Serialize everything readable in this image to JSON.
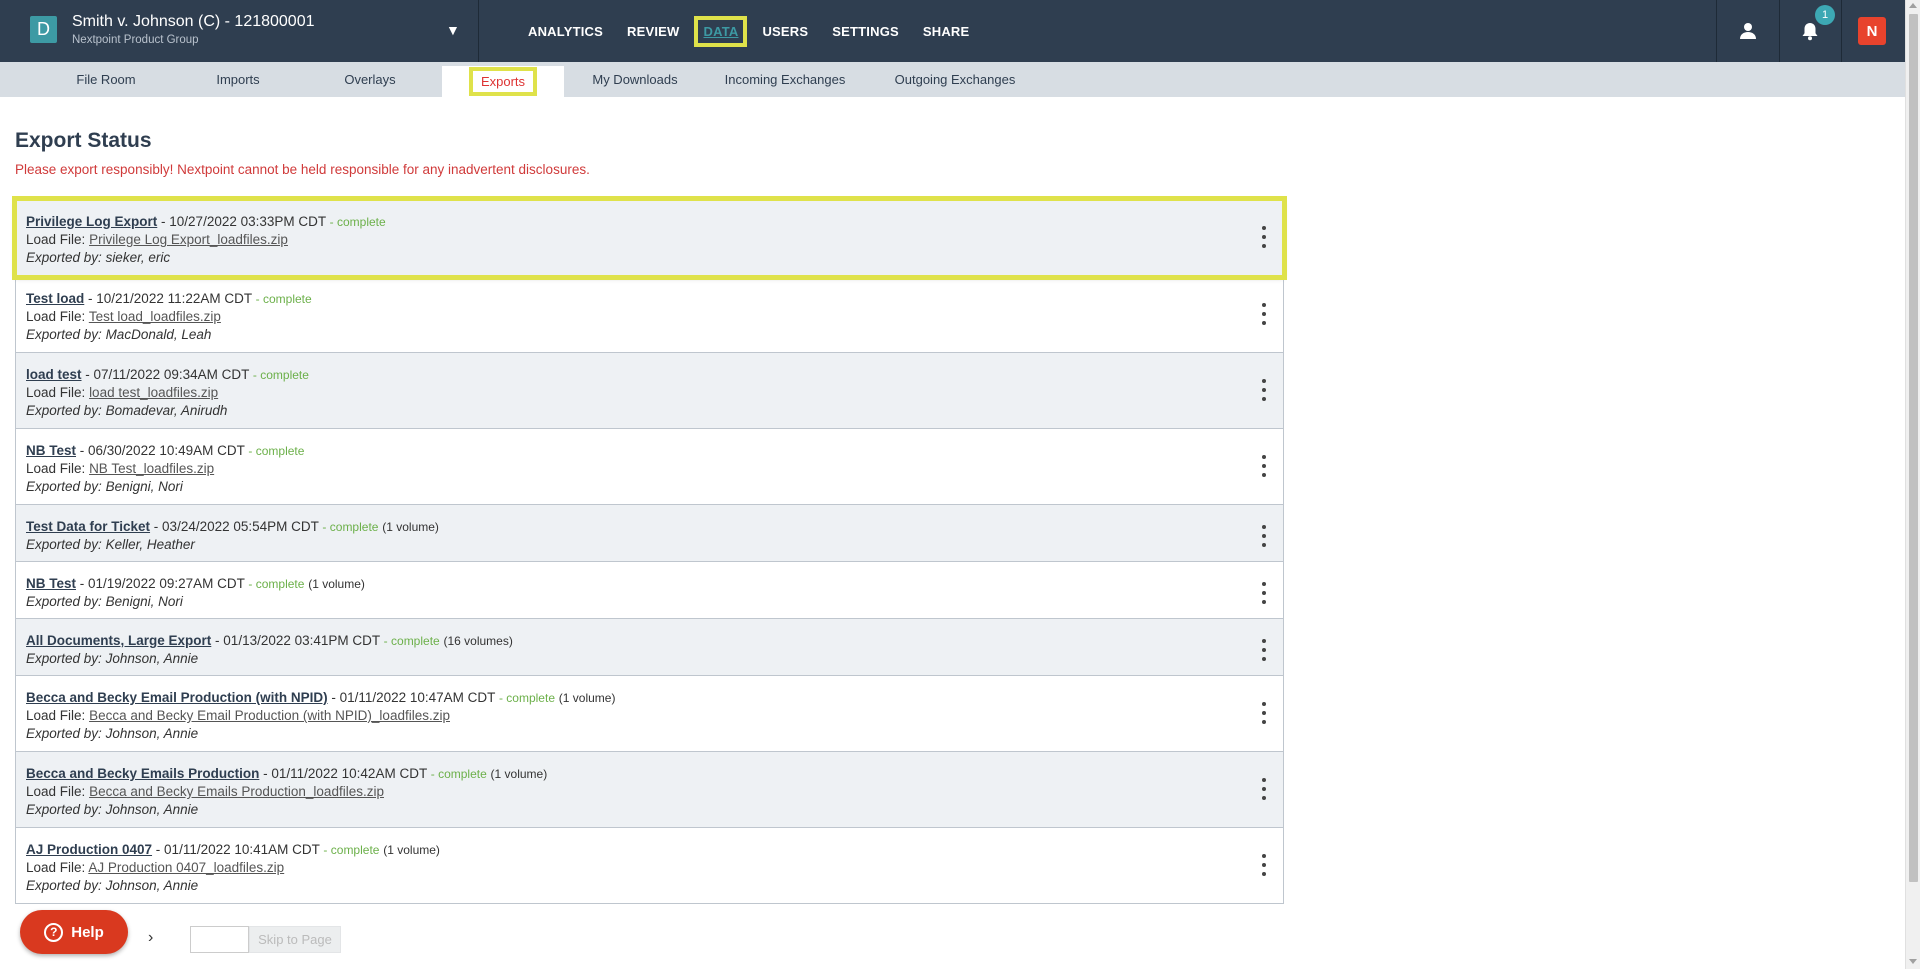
{
  "header": {
    "case_initial": "D",
    "case_title": "Smith v. Johnson (C) - 121800001",
    "case_subtitle": "Nextpoint Product Group",
    "dropdown_glyph": "▼",
    "nav": [
      "ANALYTICS",
      "REVIEW",
      "DATA",
      "USERS",
      "SETTINGS",
      "SHARE"
    ],
    "active_nav": "DATA",
    "notification_count": "1",
    "logo_text": "N"
  },
  "subnav": {
    "tabs": [
      "File Room",
      "Imports",
      "Overlays",
      "Exports",
      "My Downloads",
      "Incoming Exchanges",
      "Outgoing Exchanges"
    ],
    "active_tab": "Exports"
  },
  "page": {
    "title": "Export Status",
    "warning": "Please export responsibly! Nextpoint cannot be held responsible for any inadvertent disclosures."
  },
  "labels": {
    "load_file": "Load File:",
    "exported_by": "Exported by:"
  },
  "exports": [
    {
      "name": "Privilege Log Export",
      "datetime": "10/27/2022 03:33PM CDT",
      "status": "complete",
      "volumes": "",
      "load_file": "Privilege Log Export_loadfiles.zip",
      "exported_by": "sieker, eric"
    },
    {
      "name": "Test load",
      "datetime": "10/21/2022 11:22AM CDT",
      "status": "complete",
      "volumes": "",
      "load_file": "Test load_loadfiles.zip",
      "exported_by": "MacDonald, Leah"
    },
    {
      "name": "load test",
      "datetime": "07/11/2022 09:34AM CDT",
      "status": "complete",
      "volumes": "",
      "load_file": "load test_loadfiles.zip",
      "exported_by": "Bomadevar, Anirudh"
    },
    {
      "name": "NB Test",
      "datetime": "06/30/2022 10:49AM CDT",
      "status": "complete",
      "volumes": "",
      "load_file": "NB Test_loadfiles.zip",
      "exported_by": "Benigni, Nori"
    },
    {
      "name": "Test Data for Ticket",
      "datetime": "03/24/2022 05:54PM CDT",
      "status": "complete",
      "volumes": "(1 volume)",
      "load_file": "",
      "exported_by": "Keller, Heather"
    },
    {
      "name": "NB Test",
      "datetime": "01/19/2022 09:27AM CDT",
      "status": "complete",
      "volumes": "(1 volume)",
      "load_file": "",
      "exported_by": "Benigni, Nori"
    },
    {
      "name": "All Documents, Large Export",
      "datetime": "01/13/2022 03:41PM CDT",
      "status": "complete",
      "volumes": "(16 volumes)",
      "load_file": "",
      "exported_by": "Johnson, Annie"
    },
    {
      "name": "Becca and Becky Email Production (with NPID)",
      "datetime": "01/11/2022 10:47AM CDT",
      "status": "complete",
      "volumes": "(1 volume)",
      "load_file": "Becca and Becky Email Production (with NPID)_loadfiles.zip",
      "exported_by": "Johnson, Annie"
    },
    {
      "name": "Becca and Becky Emails Production",
      "datetime": "01/11/2022 10:42AM CDT",
      "status": "complete",
      "volumes": "(1 volume)",
      "load_file": "Becca and Becky Emails Production_loadfiles.zip",
      "exported_by": "Johnson, Annie"
    },
    {
      "name": "AJ Production 0407",
      "datetime": "01/11/2022 10:41AM CDT",
      "status": "complete",
      "volumes": "(1 volume)",
      "load_file": "AJ Production 0407_loadfiles.zip",
      "exported_by": "Johnson, Annie"
    }
  ],
  "pagination": {
    "next_glyph": "›",
    "page_input_value": "",
    "skip_label": "Skip to Page"
  },
  "help": {
    "label": "Help",
    "glyph": "?"
  },
  "colors": {
    "header_bg": "#2f3e50",
    "highlight": "#dfe24a",
    "status_complete": "#6cb04a",
    "warning": "#d03a3a",
    "help": "#d9391f"
  }
}
